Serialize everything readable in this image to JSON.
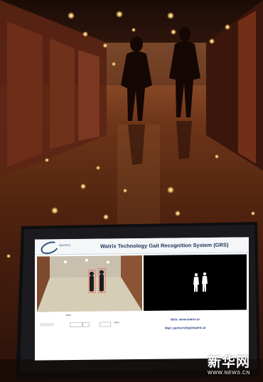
{
  "screen": {
    "logo_text": "WATRIX",
    "app_title": "Watrix Technology Gait Recognition System (GRS)",
    "web_line": "Web: www.watrix.ai",
    "mail_line": "Mail: partnership@watrix.ai"
  },
  "watermark": {
    "brand_cn": "新华网",
    "brand_url": "WWW.NEWS.CN"
  },
  "colors": {
    "floor": "#3a1a0c",
    "wall": "#5c2514",
    "accent_title": "#1c3256"
  }
}
